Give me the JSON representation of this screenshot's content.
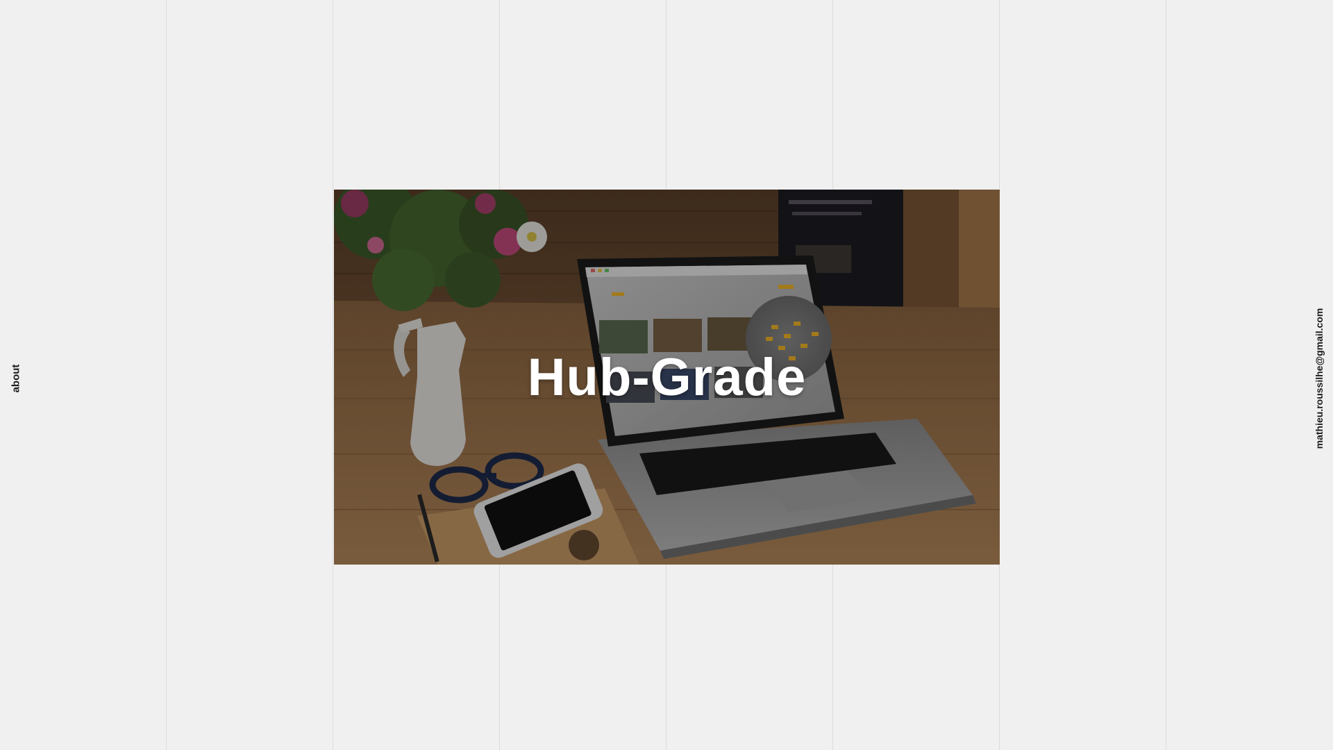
{
  "nav": {
    "about_label": "about",
    "email_label": "mathieu.roussilhe@gmail.com"
  },
  "project": {
    "title": "Hub-Grade"
  },
  "colors": {
    "background": "#f0f0f0",
    "grid_line": "#dcdcdc",
    "side_text": "#1c1c1c",
    "title_text": "#ffffff",
    "accent_yellow": "#f0b429"
  }
}
